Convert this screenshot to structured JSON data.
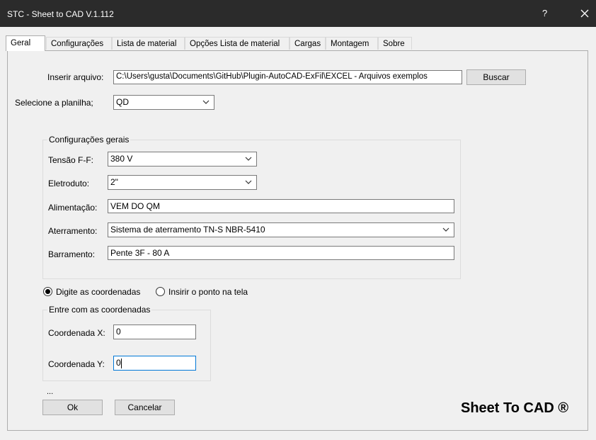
{
  "window": {
    "title": "STC - Sheet to CAD V.1.112",
    "help_label": "?"
  },
  "tabs": [
    {
      "label": "Geral"
    },
    {
      "label": "Configurações"
    },
    {
      "label": "Lista de material"
    },
    {
      "label": "Opções Lista de material"
    },
    {
      "label": "Cargas"
    },
    {
      "label": "Montagem"
    },
    {
      "label": "Sobre"
    }
  ],
  "file": {
    "label": "Inserir arquivo:",
    "value": "C:\\Users\\gusta\\Documents\\GitHub\\Plugin-AutoCAD-ExFil\\EXCEL - Arquivos exemplos",
    "browse_label": "Buscar"
  },
  "sheet": {
    "label": "Selecione a planilha;",
    "value": "QD"
  },
  "general_config": {
    "title": "Configurações gerais",
    "tensao_label": "Tensão F-F:",
    "tensao_value": "380 V",
    "eletroduto_label": "Eletroduto:",
    "eletroduto_value": "2\"",
    "alimentacao_label": "Alimentação:",
    "alimentacao_value": "VEM DO QM",
    "aterramento_label": "Aterramento:",
    "aterramento_value": "Sistema de aterramento TN-S NBR-5410",
    "barramento_label": "Barramento:",
    "barramento_value": "Pente 3F - 80 A"
  },
  "coord_mode": {
    "option_type": "Digite as coordenadas",
    "option_pick": "Insirir o ponto na tela",
    "selected": "Digite as coordenadas"
  },
  "coords": {
    "title": "Entre com as coordenadas",
    "x_label": "Coordenada X:",
    "x_value": "0",
    "y_label": "Coordenada Y:",
    "y_value": "0"
  },
  "footer": {
    "ellipsis": "...",
    "ok_label": "Ok",
    "cancel_label": "Cancelar",
    "brand": "Sheet To CAD ®"
  }
}
